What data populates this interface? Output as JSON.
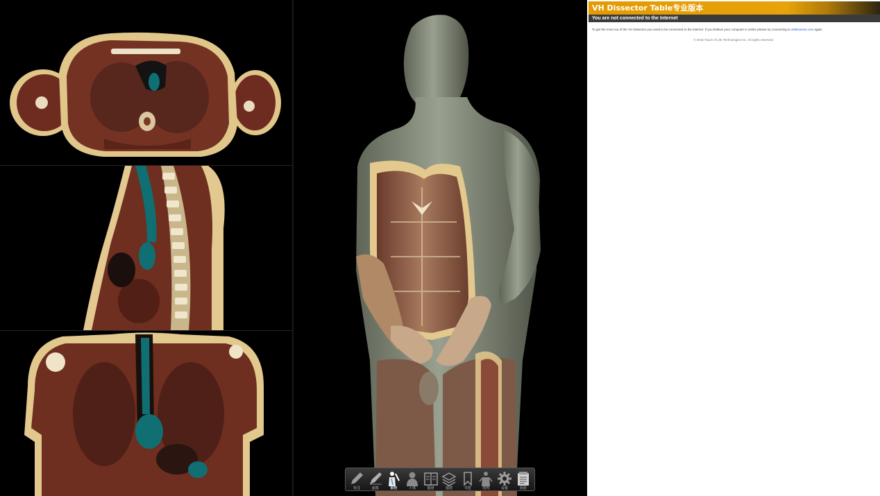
{
  "info_panel": {
    "title": "VH Dissector Table专业版本",
    "status": "You are not connected to the Internet",
    "message_before": "To get the most out of the VH Dissector you need to be connected to the internet. If you believe your computer is online please try connecting to ",
    "message_link": "vhdissector.com",
    "message_after": " again.",
    "copyright": "© 2015 Touch of Life Technologies Inc. All rights reserved."
  },
  "toolbar": {
    "tools": [
      {
        "icon": "pencil-icon",
        "label": "标注"
      },
      {
        "icon": "pen-icon",
        "label": "画笔"
      },
      {
        "icon": "dissect-figure-icon",
        "label": "解剖"
      },
      {
        "icon": "person-icon",
        "label": "人体"
      },
      {
        "icon": "book-icon",
        "label": "图谱"
      },
      {
        "icon": "layers-icon",
        "label": "图层"
      },
      {
        "icon": "bookmark-icon",
        "label": "书签"
      },
      {
        "icon": "anatomy-figure-icon",
        "label": "结构"
      },
      {
        "icon": "gear-icon",
        "label": "设置"
      },
      {
        "icon": "notepad-icon",
        "label": "测验"
      }
    ],
    "active_index": 2
  },
  "colors": {
    "background": "#000000",
    "header_accent": "#e49a00",
    "status_bar": "#3b3b3b",
    "link": "#2255cc",
    "tissue_muscle": "#6e2e20",
    "tissue_fat": "#e3c98e",
    "vessel_highlight": "#0f6f72",
    "model_skin": "#8a9080"
  }
}
